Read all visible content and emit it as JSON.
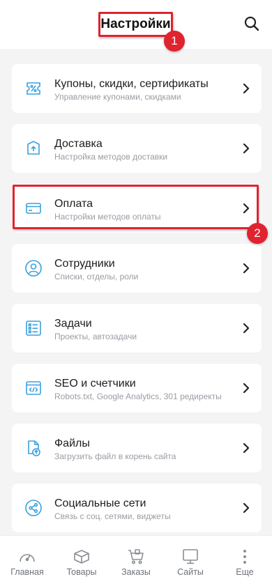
{
  "header": {
    "title": "Настройки",
    "annotation_1": "1",
    "annotation_2": "2"
  },
  "settings": [
    {
      "title": "Купоны, скидки, сертификаты",
      "subtitle": "Управление купонами, скидками",
      "icon": "coupon-icon"
    },
    {
      "title": "Доставка",
      "subtitle": "Настройка методов доставки",
      "icon": "delivery-icon"
    },
    {
      "title": "Оплата",
      "subtitle": "Настройки методов оплаты",
      "icon": "payment-card-icon"
    },
    {
      "title": "Сотрудники",
      "subtitle": "Списки, отделы, роли",
      "icon": "employees-icon"
    },
    {
      "title": "Задачи",
      "subtitle": "Проекты, автозадачи",
      "icon": "tasks-icon"
    },
    {
      "title": "SEO и счетчики",
      "subtitle": "Robots.txt, Google Analytics, 301 редиректы",
      "icon": "seo-code-icon"
    },
    {
      "title": "Файлы",
      "subtitle": "Загрузить файл в корень сайта",
      "icon": "file-upload-icon"
    },
    {
      "title": "Социальные сети",
      "subtitle": "Связь с соц. сетями, виджеты",
      "icon": "share-icon"
    }
  ],
  "bottom_nav": [
    {
      "label": "Главная",
      "icon": "dashboard-gauge-icon"
    },
    {
      "label": "Товары",
      "icon": "box-icon"
    },
    {
      "label": "Заказы",
      "icon": "cart-icon"
    },
    {
      "label": "Сайты",
      "icon": "monitor-icon"
    },
    {
      "label": "Еще",
      "icon": "more-dots-icon"
    }
  ],
  "colors": {
    "accent_icon": "#3aa0dc",
    "annotation_red": "#e0232e",
    "background": "#f4f4f5"
  }
}
